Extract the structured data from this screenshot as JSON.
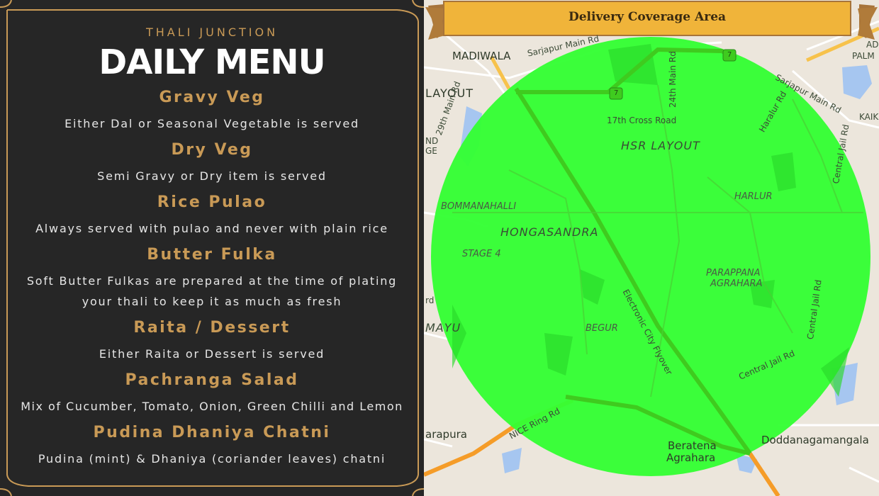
{
  "menu": {
    "brand": "THALI JUNCTION",
    "title": "DAILY MENU",
    "items": [
      {
        "name": "Gravy Veg",
        "desc": [
          "Either Dal or Seasonal Vegetable is served"
        ]
      },
      {
        "name": "Dry Veg",
        "desc": [
          "Semi Gravy or Dry item is served"
        ]
      },
      {
        "name": "Rice Pulao",
        "desc": [
          "Always served with pulao and never with plain rice"
        ]
      },
      {
        "name": "Butter Fulka",
        "desc": [
          "Soft Butter Fulkas are prepared at the time of plating",
          "your thali to keep it as much as fresh"
        ]
      },
      {
        "name": "Raita / Dessert",
        "desc": [
          "Either Raita or Dessert is served"
        ]
      },
      {
        "name": "Pachranga Salad",
        "desc": [
          "Mix of Cucumber, Tomato, Onion, Green Chilli and Lemon"
        ]
      },
      {
        "name": "Pudina Dhaniya Chatni",
        "desc": [
          "Pudina (mint) & Dhaniya (coriander leaves) chatni"
        ]
      }
    ],
    "colors": {
      "accent": "#c99a56",
      "background": "#262626",
      "text": "#e6e6e6"
    }
  },
  "map": {
    "banner_title": "Delivery Coverage Area",
    "coverage_color": "#33ff33",
    "labels": {
      "madiwala": "MADIWALA",
      "sarjapur_main_rd_top": "Sarjapur Main Rd",
      "layout": "LAYOUT",
      "rd_29th_main": "29th Main Rd",
      "rd_24th_main": "24th Main Rd",
      "rd_17th_cross": "17th Cross Road",
      "hsr_layout": "HSR LAYOUT",
      "haralur_rd": "Haralur Rd",
      "sarjapur_main_rd_right": "Sarjapur Main Rd",
      "central_jail_rd_top": "Central Jail Rd",
      "kaik": "KAIK",
      "ad": "AD",
      "palm": "PALM",
      "bommanahalli": "BOMMANAHALLI",
      "hongasandra": "HONGASANDRA",
      "stage_4": "STAGE 4",
      "harlur": "HARLUR",
      "parappana": "PARAPPANA",
      "agrahara_1": "AGRAHARA",
      "central_jail_rd_mid": "Central Jail Rd",
      "central_jail_rd_low": "Central Jail Rd",
      "electronic_city_flyover": "Electronic City Flyover",
      "begur": "BEGUR",
      "mayu": "MAYU",
      "nd": "ND",
      "ge": "GE",
      "rd_left": "rd",
      "nice_ring_rd": "NICE Ring Rd",
      "arapura": "arapura",
      "beratena": "Beratena",
      "agrahara_2": "Agrahara",
      "doddanagamangala": "Doddanagamangala",
      "shield_7a": "7",
      "shield_7b": "7"
    }
  }
}
